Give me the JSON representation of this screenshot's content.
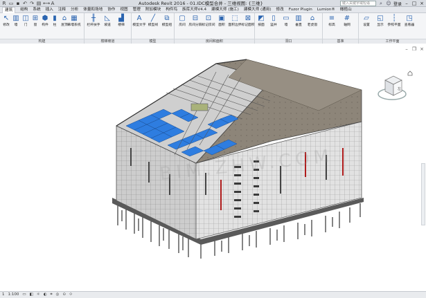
{
  "window": {
    "title": "Autodesk Revit 2016 -    01.IDC模型合并 - 三维视图: {三维}",
    "search_placeholder": "键入关键字或短语",
    "login_label": "登录",
    "qat_icons": [
      "revit-logo-icon",
      "open-icon",
      "save-icon",
      "undo-icon",
      "redo-icon",
      "print-icon",
      "measure-icon",
      "text-icon"
    ]
  },
  "menu": {
    "tabs": [
      "建筑",
      "结构",
      "系统",
      "插入",
      "注释",
      "分析",
      "体量和场地",
      "协作",
      "视图",
      "管理",
      "附加模块",
      "构件坞",
      "族库大师V4.4",
      "建模大师 (施工)",
      "建模大师 (通用)",
      "修改",
      "Fuzor Plugin",
      "Lumion®",
      "橄榄山"
    ],
    "active_index": 0
  },
  "ribbon": {
    "groups": [
      {
        "label": "构建",
        "buttons": [
          "修改",
          "墙",
          "门",
          "窗",
          "构件",
          "柱",
          "屋顶",
          "天花板",
          "楼板",
          "幕墙系统",
          "幕墙网格",
          "竖梃"
        ]
      },
      {
        "label": "楼梯坡道",
        "buttons": [
          "栏杆扶手",
          "坡道",
          "楼梯"
        ]
      },
      {
        "label": "模型",
        "buttons": [
          "模型文字",
          "模型线",
          "模型组"
        ]
      },
      {
        "label": "房间和面积",
        "buttons": [
          "房间",
          "房间分隔",
          "标记房间",
          "面积",
          "面积边界",
          "标记面积"
        ]
      },
      {
        "label": "洞口",
        "buttons": [
          "按面",
          "竖井",
          "墙",
          "垂直",
          "老虎窗"
        ]
      },
      {
        "label": "基准",
        "buttons": [
          "标高",
          "轴网"
        ]
      },
      {
        "label": "工作平面",
        "buttons": [
          "设置",
          "显示",
          "参照平面",
          "查看器"
        ]
      }
    ]
  },
  "viewport": {
    "watermark": "BIM.ZHW.COM",
    "viewcube_face": "左",
    "controls": [
      "minimize",
      "restore",
      "close"
    ]
  },
  "statusbar": {
    "view_count": "1",
    "scale": "1:100"
  },
  "colors": {
    "facade": "#c9c9c9",
    "roof_panels": "#2e7de0",
    "roof_slab": "#8c8478",
    "accent_red": "#b01c1c"
  }
}
